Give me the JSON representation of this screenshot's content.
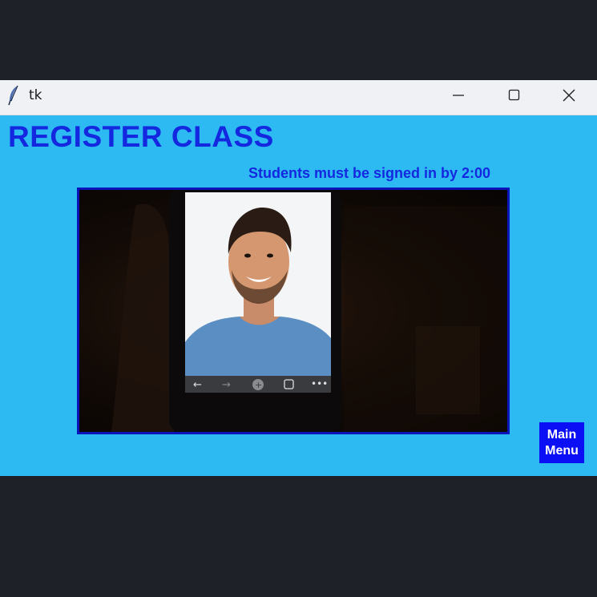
{
  "window": {
    "title": "tk",
    "icons": {
      "app": "feather-icon",
      "minimize": "minimize-icon",
      "maximize": "maximize-icon",
      "close": "close-icon"
    }
  },
  "page": {
    "heading": "REGISTER CLASS",
    "notice": "Students must be signed in by 2:00",
    "camera_feed": "camera-feed",
    "main_menu_button": "Main\nMenu"
  },
  "colors": {
    "background": "#2dbaf2",
    "heading": "#1428e0",
    "frame_border": "#0a14b8",
    "button": "#0a0ff5"
  }
}
